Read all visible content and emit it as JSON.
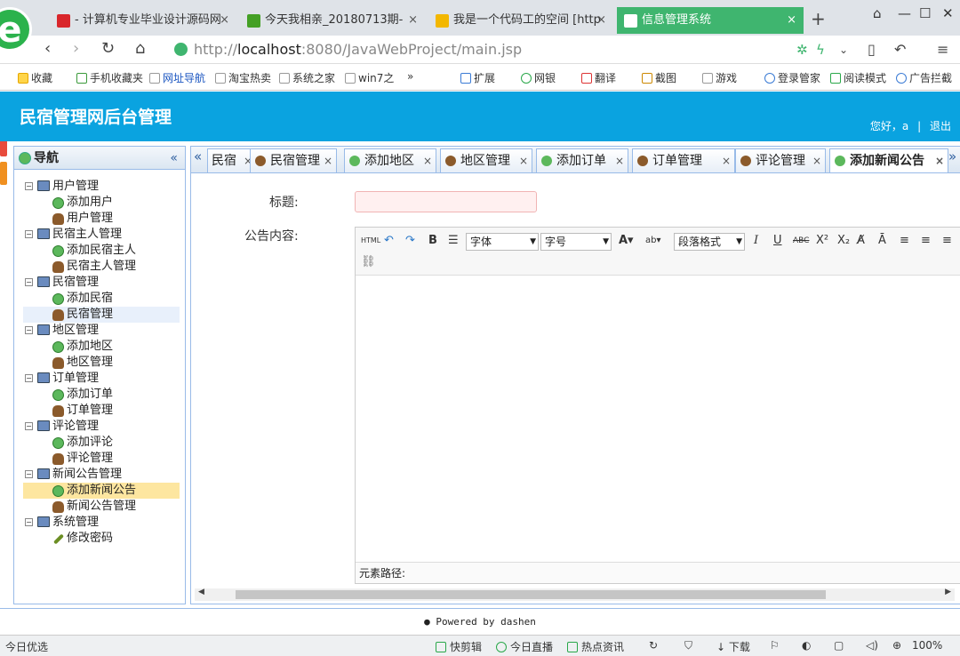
{
  "browser": {
    "tabs": [
      {
        "label": "- 计算机专业毕业设计源码网",
        "color": "#d9262b"
      },
      {
        "label": "今天我相亲_20180713期-",
        "color": "#44a025"
      },
      {
        "label": "我是一个代码工的空间 [http",
        "color": "#f3b700"
      },
      {
        "label": "信息管理系统",
        "color": "#ffffff"
      }
    ],
    "new_tab": "+",
    "url_prefix": "http://",
    "url_host": "localhost",
    "url_rest": ":8080/JavaWebProject/main.jsp"
  },
  "bookmarks": [
    "收藏",
    "手机收藏夹",
    "网址导航",
    "淘宝热卖",
    "系统之家",
    "win7之",
    "»",
    "扩展",
    "网银",
    "翻译",
    "截图",
    "游戏",
    "登录管家",
    "阅读模式",
    "广告拦截"
  ],
  "header": {
    "title": "民宿管理网后台管理",
    "greeting": "您好，a",
    "sep": "|",
    "logout": "退出"
  },
  "sidebar": {
    "title": "导航",
    "collapse": "«",
    "groups": [
      {
        "label": "用户管理",
        "items": [
          {
            "label": "添加用户",
            "icon": "add"
          },
          {
            "label": "用户管理",
            "icon": "usr"
          }
        ]
      },
      {
        "label": "民宿主人管理",
        "items": [
          {
            "label": "添加民宿主人",
            "icon": "add"
          },
          {
            "label": "民宿主人管理",
            "icon": "usr"
          }
        ]
      },
      {
        "label": "民宿管理",
        "items": [
          {
            "label": "添加民宿",
            "icon": "add"
          },
          {
            "label": "民宿管理",
            "icon": "usr"
          }
        ]
      },
      {
        "label": "地区管理",
        "items": [
          {
            "label": "添加地区",
            "icon": "add"
          },
          {
            "label": "地区管理",
            "icon": "usr"
          }
        ]
      },
      {
        "label": "订单管理",
        "items": [
          {
            "label": "添加订单",
            "icon": "add"
          },
          {
            "label": "订单管理",
            "icon": "usr"
          }
        ]
      },
      {
        "label": "评论管理",
        "items": [
          {
            "label": "添加评论",
            "icon": "add"
          },
          {
            "label": "评论管理",
            "icon": "usr"
          }
        ]
      },
      {
        "label": "新闻公告管理",
        "items": [
          {
            "label": "添加新闻公告",
            "icon": "add"
          },
          {
            "label": "新闻公告管理",
            "icon": "usr"
          }
        ]
      },
      {
        "label": "系统管理",
        "items": [
          {
            "label": "修改密码",
            "icon": "pen"
          }
        ]
      }
    ]
  },
  "page_tabs": [
    {
      "label": "民宿",
      "icon": "none"
    },
    {
      "label": "民宿管理",
      "icon": "usr"
    },
    {
      "label": "添加地区",
      "icon": "add"
    },
    {
      "label": "地区管理",
      "icon": "usr"
    },
    {
      "label": "添加订单",
      "icon": "add"
    },
    {
      "label": "订单管理",
      "icon": "usr"
    },
    {
      "label": "评论管理",
      "icon": "usr"
    },
    {
      "label": "添加新闻公告",
      "icon": "add"
    }
  ],
  "tab_scroll_left": "«",
  "tab_scroll_right": "»",
  "tab_close": "×",
  "form": {
    "title_label": "标题:",
    "title_value": "",
    "content_label": "公告内容:"
  },
  "editor": {
    "html_btn": "HTML",
    "font_family": "字体",
    "font_size": "字号",
    "paragraph": "段落格式",
    "element_path": "元素路径:"
  },
  "footer": "Powered by dashen",
  "statusbar": [
    "今日优选",
    "快剪辑",
    "今日直播",
    "热点资讯",
    "下载",
    "100%"
  ]
}
